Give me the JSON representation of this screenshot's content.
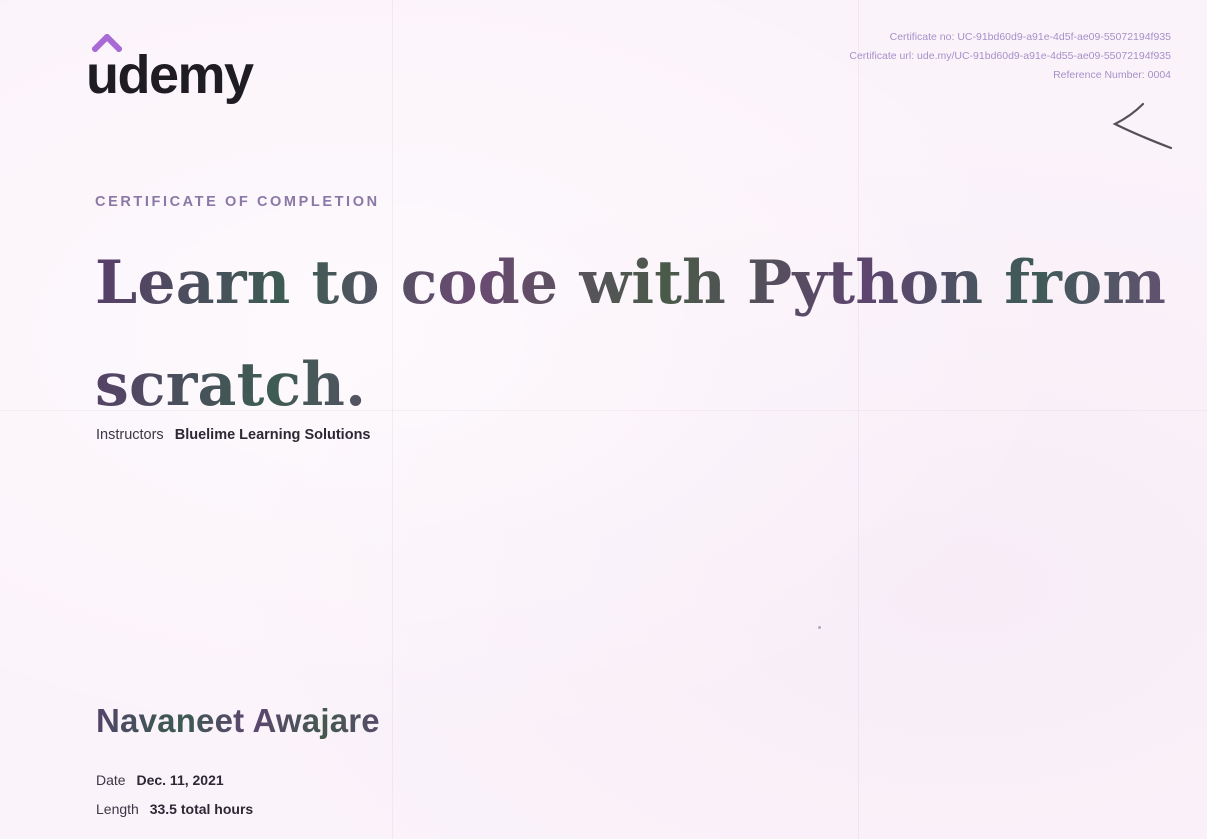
{
  "brand": {
    "name": "udemy",
    "mark_color": "#a86bd6",
    "text_color": "#1f1c24"
  },
  "meta": {
    "certificate_no": "Certificate no: UC-91bd60d9-a91e-4d5f-ae09-55072194f935",
    "certificate_url": "Certificate url: ude.my/UC-91bd60d9-a91e-4d55-ae09-55072194f935",
    "reference_number": "Reference Number: 0004"
  },
  "certificate": {
    "kicker": "CERTIFICATE OF COMPLETION",
    "course_title_line1": "Learn to code with Python from",
    "course_title_line2": "scratch.",
    "instructors_label": "Instructors",
    "instructors_value": "Bluelime Learning Solutions",
    "recipient_name": "Navaneet Awajare",
    "date_label": "Date",
    "date_value": "Dec. 11, 2021",
    "length_label": "Length",
    "length_value": "33.5 total hours"
  },
  "colors": {
    "paper": "#fbf3fa",
    "accent_text": "#8a78a6",
    "meta_text": "#a590c9"
  }
}
